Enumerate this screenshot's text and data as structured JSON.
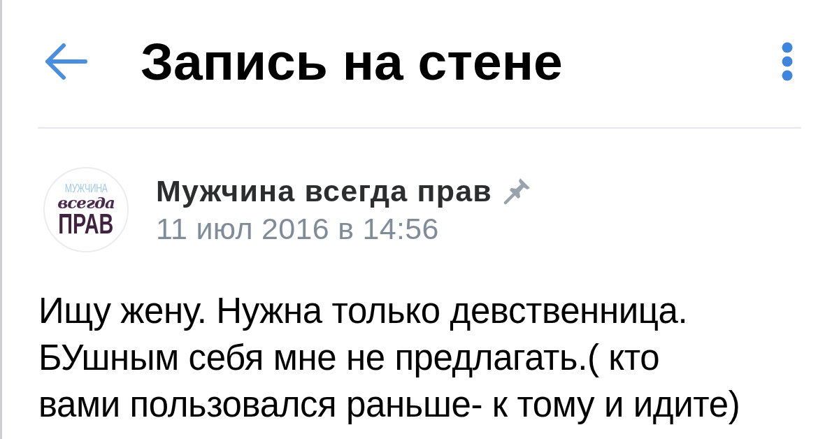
{
  "header": {
    "title": "Запись на стене"
  },
  "post": {
    "avatar": {
      "top": "МУЖЧИНА",
      "middle": "всегда",
      "bottom": "ПРАВ"
    },
    "author": "Мужчина всегда прав",
    "pinned": true,
    "date": "11 июл 2016 в 14:56",
    "text": "Ищу жену. Нужна только девственница. БУшным себя мне не предлагать.( кто вами пользовался раньше- к тому и идите)"
  }
}
